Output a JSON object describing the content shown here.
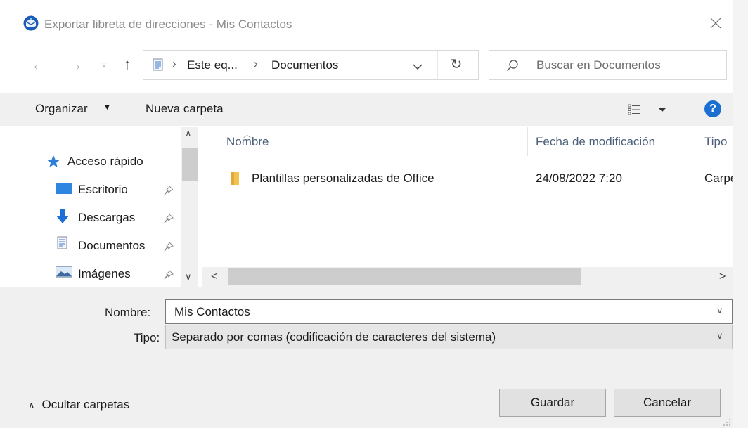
{
  "window": {
    "title": "Exportar libreta de direcciones - Mis Contactos",
    "close_icon": "close-icon"
  },
  "address_bar": {
    "crumbs": [
      "Este eq...",
      "Documentos"
    ],
    "separator": "›",
    "refresh_icon": "refresh-icon"
  },
  "search": {
    "placeholder": "Buscar en Documentos"
  },
  "toolbar": {
    "organize_label": "Organizar",
    "new_folder_label": "Nueva carpeta",
    "help_label": "?"
  },
  "nav_pane": {
    "quick_access": "Acceso rápido",
    "items": [
      {
        "label": "Escritorio",
        "icon": "desktop-icon",
        "pinned": true
      },
      {
        "label": "Descargas",
        "icon": "download-icon",
        "pinned": true
      },
      {
        "label": "Documentos",
        "icon": "document-icon",
        "pinned": true
      },
      {
        "label": "Imágenes",
        "icon": "picture-icon",
        "pinned": true
      }
    ]
  },
  "file_list": {
    "columns": [
      "Nombre",
      "Fecha de modificación",
      "Tipo"
    ],
    "rows": [
      {
        "name": "Plantillas personalizadas de Office",
        "modified": "24/08/2022 7:20",
        "type": "Carpe"
      }
    ]
  },
  "form": {
    "name_label": "Nombre:",
    "name_value": "Mis Contactos",
    "type_label": "Tipo:",
    "type_value": "Separado por comas (codificación de caracteres del sistema)"
  },
  "footer": {
    "hide_folders_label": "Ocultar carpetas",
    "save_label": "Guardar",
    "cancel_label": "Cancelar"
  },
  "colors": {
    "accent": "#1a6fd1",
    "folder": "#f2c14e",
    "header_text": "#4c607a"
  }
}
